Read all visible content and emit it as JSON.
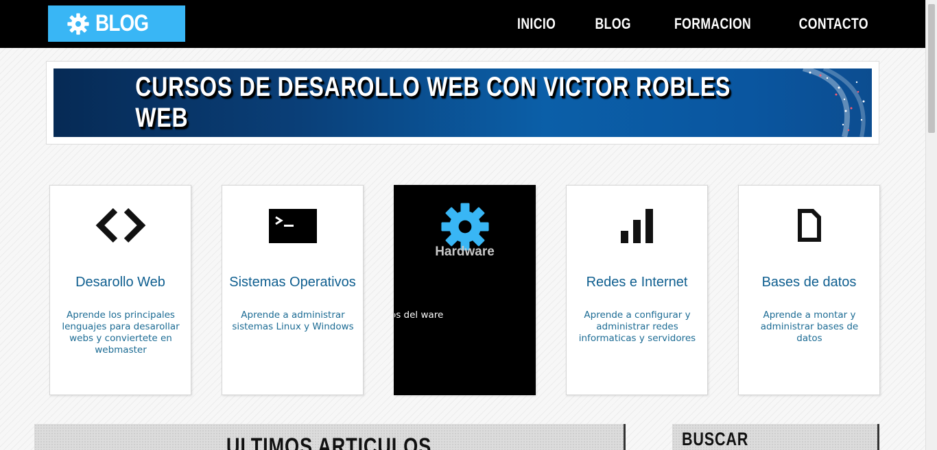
{
  "header": {
    "logo_text": "BLOG",
    "logo_icon": "gear-icon",
    "nav": [
      "INICIO",
      "BLOG",
      "FORMACION",
      "CONTACTO"
    ]
  },
  "banner": {
    "title": "CURSOS DE DESAROLLO WEB CON VICTOR ROBLES WEB"
  },
  "cards": [
    {
      "icon": "code-brackets-icon",
      "title": "Desarollo Web",
      "description": "Aprende los principales lenguajes para desarollar webs y conviertete en webmaster"
    },
    {
      "icon": "terminal-icon",
      "title": "Sistemas Operativos",
      "description": "Aprende a administrar sistemas Linux y Windows"
    },
    {
      "icon": "gear-icon",
      "title": "Hardware",
      "description": "ntresijos del ware"
    },
    {
      "icon": "signal-bars-icon",
      "title": "Redes e Internet",
      "description": "Aprende a configurar y administrar redes informaticas y servidores"
    },
    {
      "icon": "document-icon",
      "title": "Bases de datos",
      "description": "Aprende a montar y administrar bases de datos"
    }
  ],
  "sections": {
    "latest_title": "ULTIMOS ARTICULOS",
    "search_title": "BUSCAR"
  },
  "colors": {
    "accent": "#39b6f5",
    "header_bg": "#000000",
    "card_title": "#0e5e8f"
  }
}
